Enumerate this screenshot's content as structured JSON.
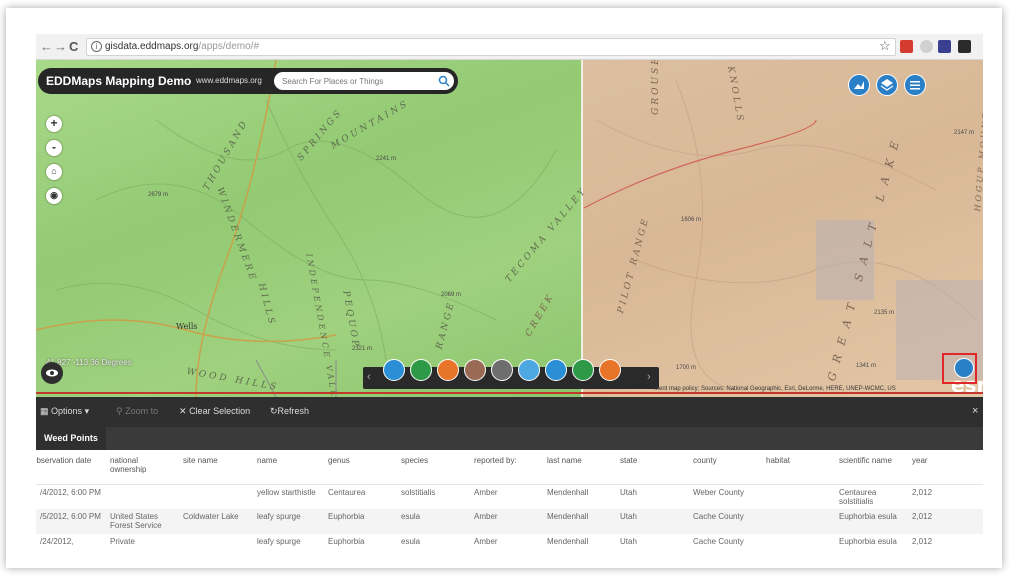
{
  "browser": {
    "url_host": "gisdata.eddmaps.org",
    "url_path": "/apps/demo/#",
    "icons": [
      "back-icon",
      "forward-icon",
      "reload-icon",
      "info-icon",
      "star-icon",
      "extension-icon"
    ]
  },
  "header": {
    "title": "EDDMaps Mapping Demo",
    "site": "www.eddmaps.org",
    "search_placeholder": "Search For Places or Things"
  },
  "map": {
    "zoom_in": "+",
    "zoom_out": "-",
    "coords": "41.827 -113.36 Degrees",
    "labels_left": [
      "THOUSAND",
      "SPRINGS",
      "WINDERMERE",
      "HILLS",
      "PEQUOP",
      "MOUNTAINS",
      "INDEPENDENCE VALLEY",
      "TECOMA VALLEY",
      "RANGE",
      "WOOD HILLS",
      "Wells"
    ],
    "labels_right": [
      "GROUSE",
      "CREEK",
      "PILOT RANGE",
      "GREAT SALT LAKE",
      "HOGUP MOUNTAINS",
      "KNOLLS"
    ],
    "elevations": [
      "2241 m",
      "2679 m",
      "2069 m",
      "2321 m",
      "1606 m",
      "2147 m",
      "2135 m",
      "1700 m",
      "1341 m"
    ],
    "attribution": "ment map policy; Sources: National Geographic, Esri, DeLorme, HERE, UNEP-WCMC, US",
    "esri": "esri",
    "colors": {
      "left": "#9fd17f",
      "right": "#dcbfa0",
      "accent": "#2b7fc7"
    }
  },
  "toolbar": {
    "tools": [
      {
        "name": "search-tool",
        "color": "#2b8fd6"
      },
      {
        "name": "basemap-tool",
        "color": "#2e9a48"
      },
      {
        "name": "layers-tool",
        "color": "#e8742a"
      },
      {
        "name": "grid-tool",
        "color": "#9a6a55"
      },
      {
        "name": "draw-tool",
        "color": "#6e6e6e"
      },
      {
        "name": "print-tool",
        "color": "#4da7e0"
      },
      {
        "name": "share-tool",
        "color": "#2b8fd6"
      },
      {
        "name": "legend-tool",
        "color": "#2e9a48"
      },
      {
        "name": "info-tool",
        "color": "#e8742a"
      }
    ]
  },
  "panel": {
    "options": "Options",
    "zoom_to": "Zoom to",
    "clear_selection": "Clear Selection",
    "refresh": "Refresh",
    "close": "×",
    "tab": "Weed Points",
    "columns": [
      "observation date",
      "national ownership",
      "site name",
      "name",
      "genus",
      "species",
      "reported by:",
      "last name",
      "state",
      "county",
      "habitat",
      "scientific name",
      "year"
    ],
    "rows": [
      [
        "/4/2012, 6:00 PM",
        "",
        "",
        "yellow starthistle",
        "Centaurea",
        "solstitialis",
        "Amber",
        "Mendenhall",
        "Utah",
        "Weber County",
        "",
        "Centaurea solstitialis",
        "2,012"
      ],
      [
        "/5/2012, 6:00 PM",
        "United States Forest Service",
        "Coldwater Lake",
        "leafy spurge",
        "Euphorbia",
        "esula",
        "Amber",
        "Mendenhall",
        "Utah",
        "Cache County",
        "",
        "Euphorbia esula",
        "2,012"
      ],
      [
        "/24/2012,",
        "Private",
        "",
        "leafy spurge",
        "Euphorbia",
        "esula",
        "Amber",
        "Mendenhall",
        "Utah",
        "Cache County",
        "",
        "Euphorbia esula",
        "2,012"
      ]
    ]
  }
}
